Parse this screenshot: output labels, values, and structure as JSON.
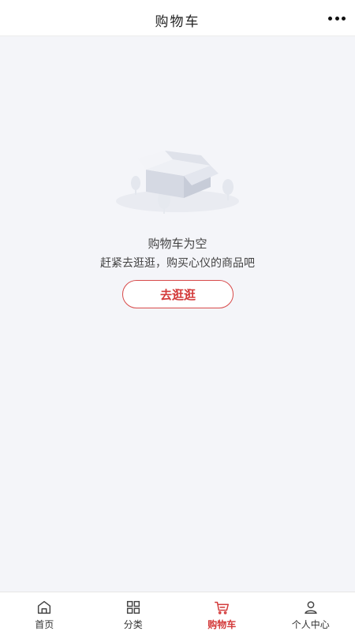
{
  "header": {
    "title": "购物车",
    "more_icon": "more-dots-icon"
  },
  "empty_state": {
    "illustration": "empty-box-icon",
    "title": "购物车为空",
    "subtitle": "赶紧去逛逛，购买心仪的商品吧",
    "button_label": "去逛逛"
  },
  "tabbar": {
    "active": "cart",
    "active_color": "#d33a3a",
    "items": [
      {
        "key": "home",
        "label": "首页",
        "icon": "home-icon"
      },
      {
        "key": "category",
        "label": "分类",
        "icon": "grid-icon"
      },
      {
        "key": "cart",
        "label": "购物车",
        "icon": "cart-icon"
      },
      {
        "key": "profile",
        "label": "个人中心",
        "icon": "user-icon"
      }
    ]
  }
}
